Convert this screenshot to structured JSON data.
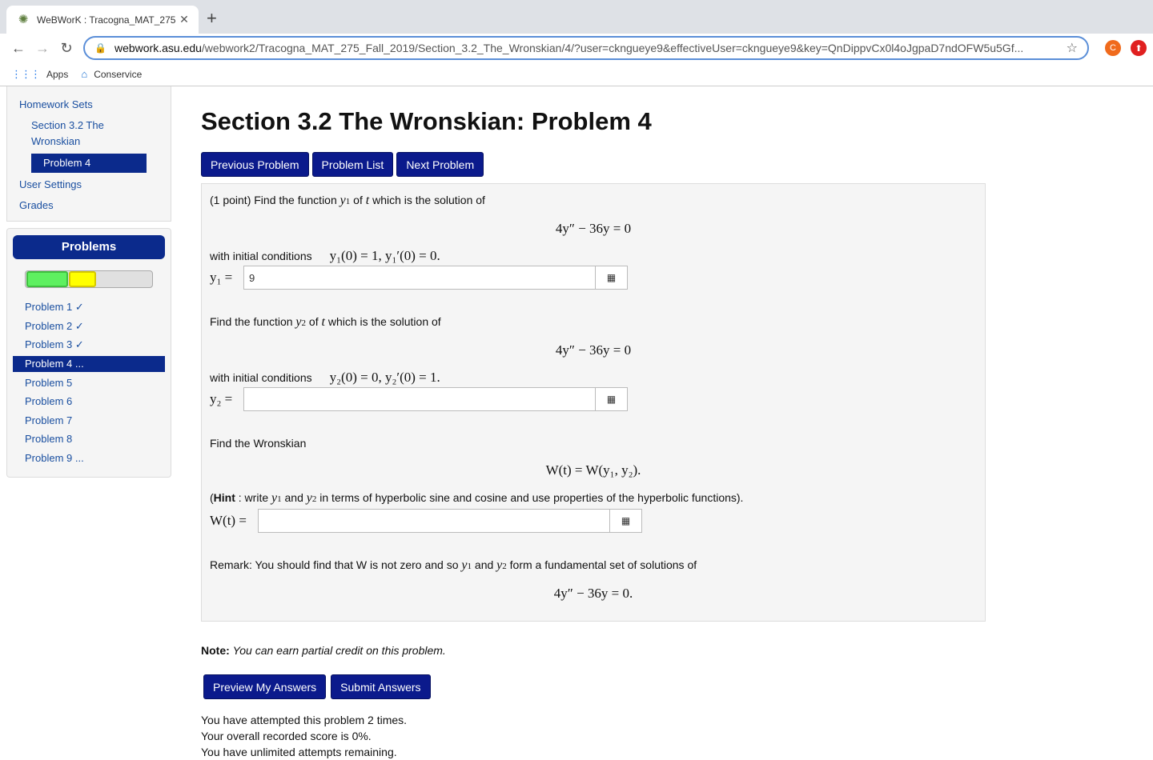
{
  "browser": {
    "tab_title": "WeBWorK : Tracogna_MAT_275",
    "url_host": "webwork.asu.edu",
    "url_path": "/webwork2/Tracogna_MAT_275_Fall_2019/Section_3.2_The_Wronskian/4/?user=ckngueye9&effectiveUser=ckngueye9&key=QnDippvCx0l4oJgpaD7ndOFW5u5Gf...",
    "ext_c_label": "C",
    "bookmarks": [
      {
        "label": "Apps"
      },
      {
        "label": "Conservice"
      }
    ]
  },
  "sidebar": {
    "homework_sets": "Homework Sets",
    "section_link": "Section 3.2 The Wronskian",
    "problem_active": "Problem 4",
    "user_settings": "User Settings",
    "grades": "Grades",
    "problems_heading": "Problems",
    "progress": {
      "correct_fraction": 0.33,
      "partial_fraction": 0.21
    },
    "problem_list": [
      {
        "label": "Problem 1 ✓"
      },
      {
        "label": "Problem 2 ✓"
      },
      {
        "label": "Problem 3 ✓"
      },
      {
        "label": "Problem 4 ..."
      },
      {
        "label": "Problem 5"
      },
      {
        "label": "Problem 6"
      },
      {
        "label": "Problem 7"
      },
      {
        "label": "Problem 8"
      },
      {
        "label": "Problem 9 ..."
      }
    ]
  },
  "main": {
    "title": "Section 3.2 The Wronskian: Problem 4",
    "nav": {
      "previous": "Previous Problem",
      "list": "Problem List",
      "next": "Next Problem"
    },
    "problem": {
      "intro_prefix": "(1 point) Find the function",
      "intro_suffix": "of",
      "intro_tail": "which is the solution of",
      "equation": "4y″ − 36y = 0",
      "ic_label": "with initial conditions",
      "ic1": "y₁(0) = 1,    y₁′(0) = 0.",
      "y1_label": "y₁ =",
      "y1_value": "9",
      "q2_prefix": "Find the function",
      "q2_suffix": "of",
      "q2_tail": "which is the solution of",
      "ic2": "y₂(0) = 0,    y₂′(0) = 1.",
      "y2_label": "y₂ =",
      "y2_value": "",
      "wronskian_text": "Find the Wronskian",
      "wronskian_eq": "W(t) = W(y₁, y₂).",
      "hint_bold": "Hint",
      "hint_text_a": ": write",
      "hint_text_b": "and",
      "hint_text_c": "in terms of hyperbolic sine and cosine and use properties of the hyperbolic functions).",
      "w_label": "W(t) =",
      "w_value": "",
      "remark_a": "Remark: You should find that W is not zero and so",
      "remark_b": "and",
      "remark_c": "form a fundamental set of solutions of",
      "remark_eq": "4y″ − 36y = 0."
    },
    "note_bold": "Note:",
    "note_text": "You can earn partial credit on this problem.",
    "preview": "Preview My Answers",
    "submit": "Submit Answers",
    "attempts": [
      "You have attempted this problem 2 times.",
      "Your overall recorded score is 0%.",
      "You have unlimited attempts remaining."
    ]
  }
}
